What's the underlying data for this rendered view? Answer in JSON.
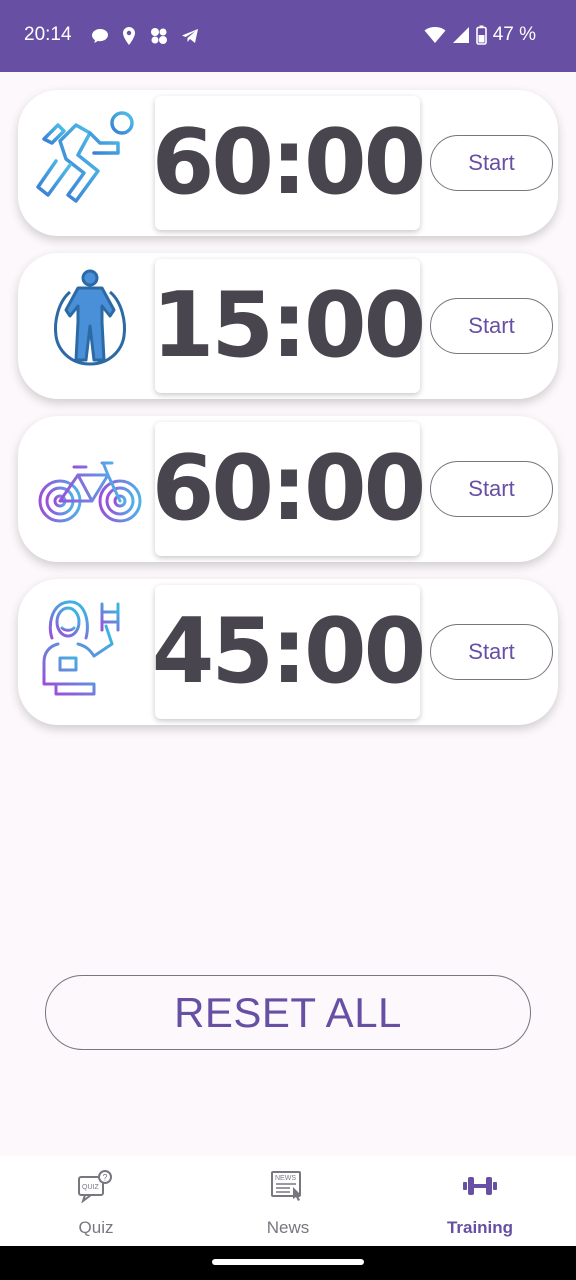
{
  "status_bar": {
    "time": "20:14",
    "battery": "47 %",
    "left_icons": [
      "message-icon",
      "location-icon",
      "apps-icon",
      "telegram-icon"
    ],
    "right_icons": [
      "wifi-icon",
      "signal-icon",
      "battery-icon"
    ],
    "color": "#6750a4"
  },
  "timers": [
    {
      "activity_icon": "running-icon",
      "time": "60:00",
      "button": "Start"
    },
    {
      "activity_icon": "jump-rope-icon",
      "time": "15:00",
      "button": "Start"
    },
    {
      "activity_icon": "bicycle-icon",
      "time": "60:00",
      "button": "Start"
    },
    {
      "activity_icon": "dumbbell-woman-icon",
      "time": "45:00",
      "button": "Start"
    }
  ],
  "reset_all_label": "RESET ALL",
  "bottom_nav": {
    "items": [
      {
        "label": "Quiz",
        "icon": "quiz-icon",
        "active": false
      },
      {
        "label": "News",
        "icon": "news-icon",
        "active": false
      },
      {
        "label": "Training",
        "icon": "dumbbell-icon",
        "active": true
      }
    ]
  },
  "colors": {
    "accent": "#6750a4",
    "timer_text": "#48454e",
    "outline": "#79747e",
    "background": "#fcf8fc"
  }
}
